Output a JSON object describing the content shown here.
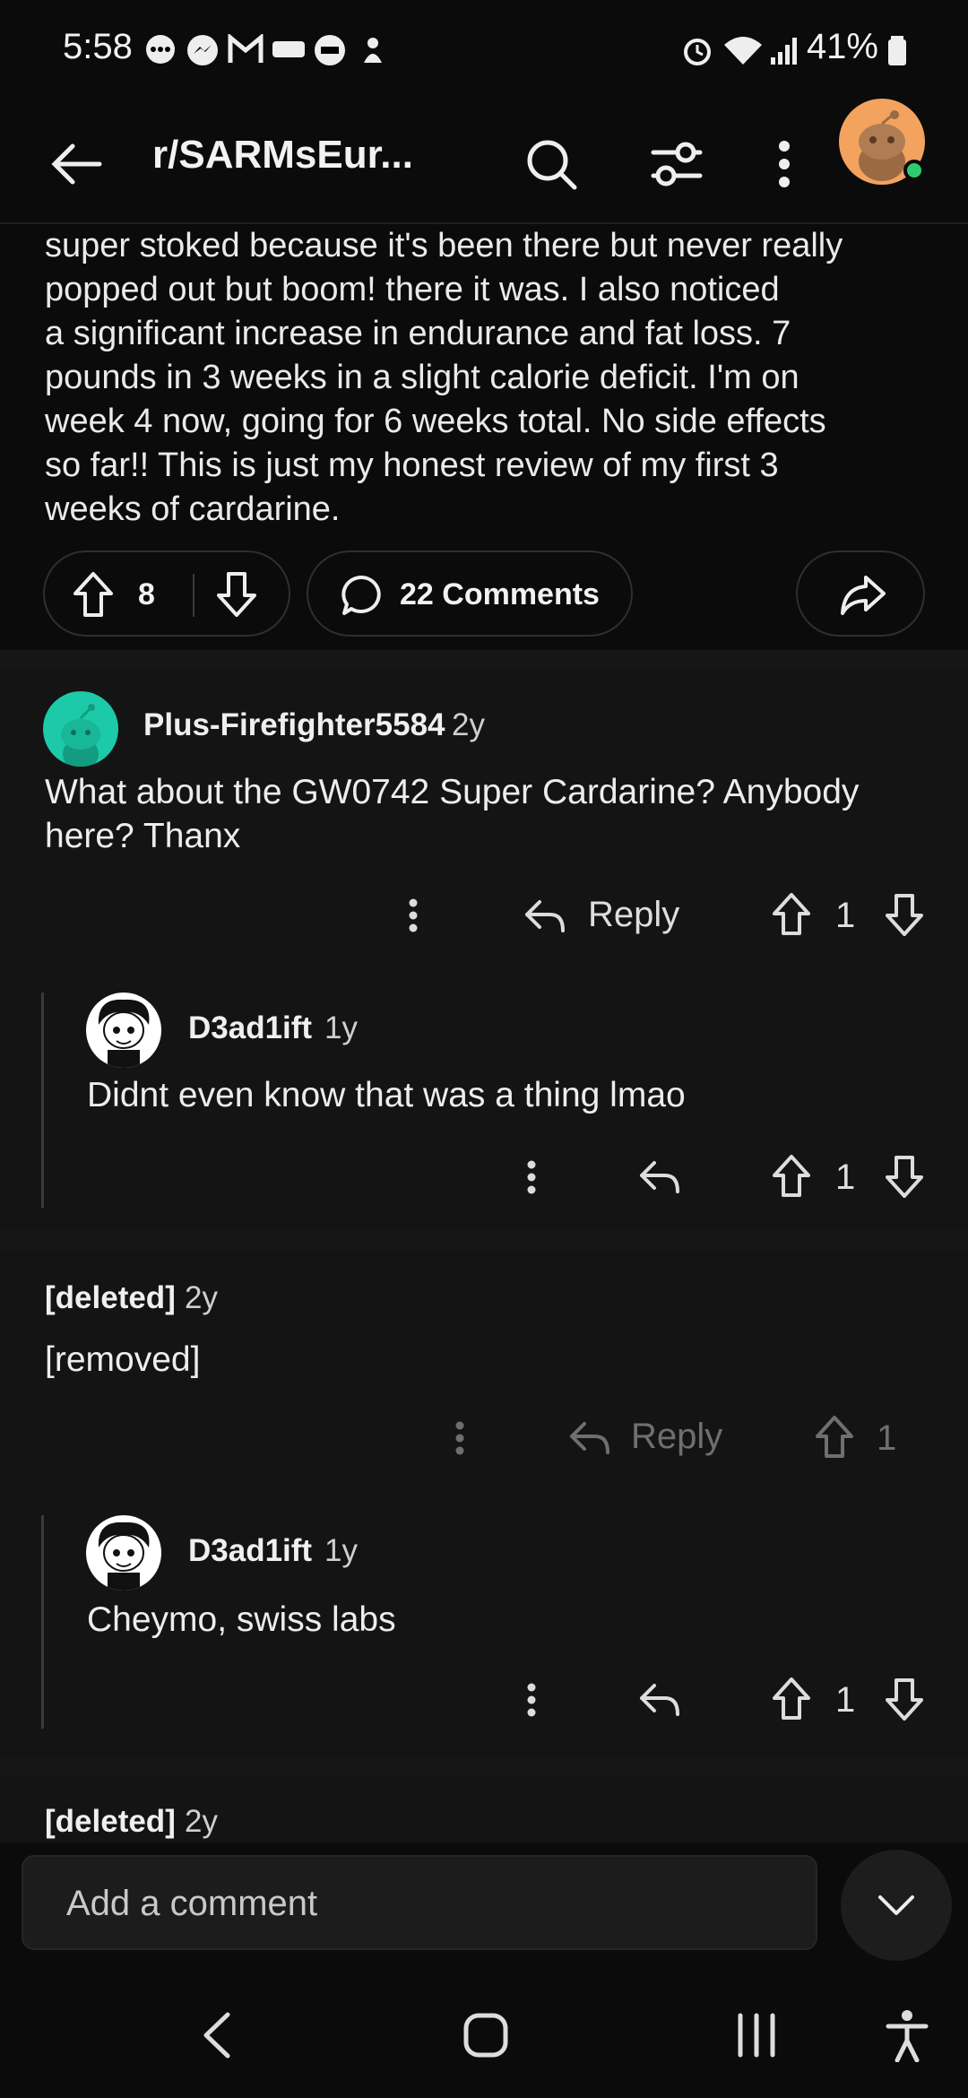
{
  "status_bar": {
    "time": "5:58",
    "battery": "41%"
  },
  "top_bar": {
    "subreddit": "r/SARMsEur..."
  },
  "post": {
    "lines": [
      "super stoked because it's been there but never really",
      "popped out but boom! there it was. I also noticed",
      "a significant increase in endurance and fat loss. 7",
      "pounds in 3 weeks in a slight calorie deficit. I'm on",
      "week 4 now, going for 6 weeks total. No side effects",
      "so far!!  This is just my honest review of my first 3",
      "weeks of cardarine."
    ],
    "votes": "8",
    "comments_label": "22 Comments"
  },
  "comments": [
    {
      "author": "Plus-Firefighter5584",
      "age": "2y",
      "text_lines": [
        "What about the GW0742 Super Cardarine? Anybody",
        "here?  Thanx"
      ],
      "reply_label": "Reply",
      "score": "1",
      "replies": [
        {
          "author": "D3ad1ift",
          "age": "1y",
          "text": "Didnt even know that was a thing lmao",
          "score": "1"
        }
      ]
    },
    {
      "author": "[deleted]",
      "age": "2y",
      "text": "[removed]",
      "reply_label": "Reply",
      "score": "1",
      "replies": [
        {
          "author": "D3ad1ift",
          "age": "1y",
          "text": "Cheymo, swiss labs",
          "score": "1"
        }
      ]
    },
    {
      "author": "[deleted]",
      "age": "2y"
    }
  ],
  "comment_bar": {
    "placeholder": "Add a comment"
  }
}
